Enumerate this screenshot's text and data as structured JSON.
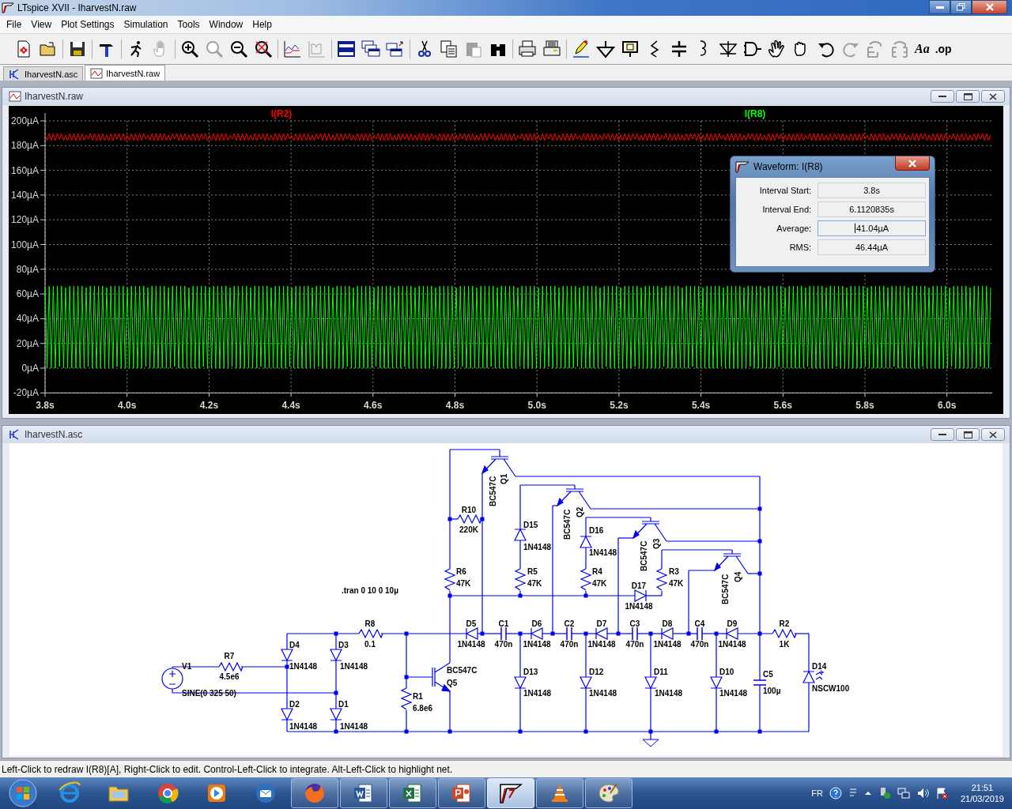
{
  "window": {
    "title": "LTspice XVII - IharvestN.raw"
  },
  "menu": [
    "File",
    "View",
    "Plot Settings",
    "Simulation",
    "Tools",
    "Window",
    "Help"
  ],
  "toolbar": [
    [
      {
        "disabled": false
      },
      {
        "disabled": false
      }
    ],
    [
      {
        "disabled": false
      }
    ],
    [
      {
        "disabled": false
      }
    ],
    [
      {
        "disabled": false
      },
      {
        "disabled": true
      }
    ],
    [
      {
        "disabled": false
      },
      {
        "disabled": true
      },
      {
        "disabled": false
      },
      {
        "disabled": false
      }
    ],
    [
      {
        "disabled": false
      },
      {
        "disabled": true
      }
    ],
    [
      {
        "disabled": false
      },
      {
        "disabled": false
      },
      {
        "disabled": false
      }
    ],
    [
      {
        "disabled": false
      },
      {
        "disabled": false
      },
      {
        "disabled": true
      },
      {
        "disabled": false
      }
    ],
    [
      {
        "disabled": false
      },
      {
        "disabled": false
      }
    ],
    [
      {
        "disabled": false
      },
      {
        "disabled": false
      },
      {
        "disabled": false
      },
      {
        "disabled": false
      },
      {
        "disabled": false
      },
      {
        "disabled": false
      },
      {
        "disabled": false
      },
      {
        "disabled": false
      },
      {
        "disabled": false
      },
      {
        "disabled": false
      },
      {
        "disabled": false
      },
      {
        "disabled": true
      },
      {
        "disabled": true
      },
      {
        "disabled": true
      },
      {
        "disabled": false,
        "label": "Aa"
      },
      {
        "disabled": false,
        "label": ".op"
      }
    ]
  ],
  "tabs": [
    {
      "label": "IharvestN.asc",
      "selected": false
    },
    {
      "label": "IharvestN.raw",
      "selected": true
    }
  ],
  "plot_window": {
    "title": "IharvestN.raw",
    "traces": [
      {
        "name": "I(R2)",
        "color": "#ff0000"
      },
      {
        "name": "I(R8)",
        "color": "#00ff00"
      }
    ],
    "y_axis_labels": [
      "200µA",
      "180µA",
      "160µA",
      "140µA",
      "120µA",
      "100µA",
      "80µA",
      "60µA",
      "40µA",
      "20µA",
      "0µA",
      "-20µA"
    ],
    "x_axis_labels": [
      "3.8s",
      "4.0s",
      "4.2s",
      "4.4s",
      "4.6s",
      "4.8s",
      "5.0s",
      "5.2s",
      "5.4s",
      "5.6s",
      "5.8s",
      "6.0s"
    ]
  },
  "measure_dialog": {
    "title": "Waveform: I(R8)",
    "fields": [
      {
        "label": "Interval Start:",
        "value": "3.8s",
        "focused": false
      },
      {
        "label": "Interval End:",
        "value": "6.1120835s",
        "focused": false
      },
      {
        "label": "Average:",
        "value": "41.04µA",
        "focused": true
      },
      {
        "label": "RMS:",
        "value": "46.44µA",
        "focused": false
      }
    ]
  },
  "schematic_window": {
    "title": "IharvestN.asc",
    "directive": ".tran 0 10 0 10µ",
    "components": [
      {
        "kind": "npn",
        "ref": "Q1",
        "value": "BC547C"
      },
      {
        "kind": "npn",
        "ref": "Q2",
        "value": "BC547C"
      },
      {
        "kind": "resistor",
        "ref": "R10",
        "value": "220K"
      },
      {
        "kind": "npn",
        "ref": "Q3",
        "value": "BC547C"
      },
      {
        "kind": "diode",
        "ref": "D15",
        "value": "1N4148"
      },
      {
        "kind": "diode",
        "ref": "D16",
        "value": "1N4148"
      },
      {
        "kind": "npn",
        "ref": "Q4",
        "value": "BC547C"
      },
      {
        "kind": "resistor",
        "ref": "R6",
        "value": "47K"
      },
      {
        "kind": "resistor",
        "ref": "R5",
        "value": "47K"
      },
      {
        "kind": "resistor",
        "ref": "R4",
        "value": "47K"
      },
      {
        "kind": "resistor",
        "ref": "R3",
        "value": "47K"
      },
      {
        "kind": "diode",
        "ref": "D17",
        "value": "1N4148"
      },
      {
        "kind": "resistor",
        "ref": "R8",
        "value": "0.1"
      },
      {
        "kind": "diode",
        "ref": "D5",
        "value": "1N4148"
      },
      {
        "kind": "capacitor",
        "ref": "C1",
        "value": "470n"
      },
      {
        "kind": "diode",
        "ref": "D6",
        "value": "1N4148"
      },
      {
        "kind": "capacitor",
        "ref": "C2",
        "value": "470n"
      },
      {
        "kind": "diode",
        "ref": "D7",
        "value": "1N4148"
      },
      {
        "kind": "capacitor",
        "ref": "C3",
        "value": "470n"
      },
      {
        "kind": "diode",
        "ref": "D8",
        "value": "1N4148"
      },
      {
        "kind": "capacitor",
        "ref": "C4",
        "value": "470n"
      },
      {
        "kind": "diode",
        "ref": "D9",
        "value": "1N4148"
      },
      {
        "kind": "resistor",
        "ref": "R2",
        "value": "1K"
      },
      {
        "kind": "diode",
        "ref": "D4",
        "value": "1N4148"
      },
      {
        "kind": "diode",
        "ref": "D3",
        "value": "1N4148"
      },
      {
        "kind": "resistor",
        "ref": "R7",
        "value": "4.5e6"
      },
      {
        "kind": "source",
        "ref": "V1",
        "value": "SINE(0 325 50)"
      },
      {
        "kind": "npn",
        "ref": "Q5",
        "value": "BC547C"
      },
      {
        "kind": "diode",
        "ref": "D13",
        "value": "1N4148"
      },
      {
        "kind": "diode",
        "ref": "D12",
        "value": "1N4148"
      },
      {
        "kind": "diode",
        "ref": "D11",
        "value": "1N4148"
      },
      {
        "kind": "diode",
        "ref": "D10",
        "value": "1N4148"
      },
      {
        "kind": "capacitor",
        "ref": "C5",
        "value": "100µ"
      },
      {
        "kind": "led",
        "ref": "D14",
        "value": "NSCW100"
      },
      {
        "kind": "resistor",
        "ref": "R1",
        "value": "6.8e6"
      },
      {
        "kind": "diode",
        "ref": "D2",
        "value": "1N4148"
      },
      {
        "kind": "diode",
        "ref": "D1",
        "value": "1N4148"
      }
    ]
  },
  "status_bar": "Left-Click to redraw I(R8)[A],  Right-Click to edit. Control-Left-Click to integrate. Alt-Left-Click to highlight net.",
  "taskbar": {
    "apps": [
      {
        "running": false,
        "selected": false
      },
      {
        "running": false,
        "selected": false
      },
      {
        "running": false,
        "selected": false
      },
      {
        "running": false,
        "selected": false
      },
      {
        "running": false,
        "selected": false
      },
      {
        "running": true,
        "selected": false
      },
      {
        "running": true,
        "selected": false
      },
      {
        "running": true,
        "selected": false
      },
      {
        "running": true,
        "selected": false
      },
      {
        "running": true,
        "selected": true
      },
      {
        "running": true,
        "selected": false
      },
      {
        "running": true,
        "selected": false
      }
    ],
    "language": "FR",
    "time": "21:51",
    "date": "21/03/2019"
  }
}
